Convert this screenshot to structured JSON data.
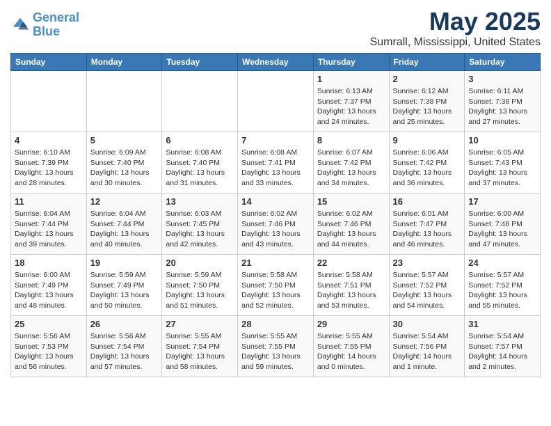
{
  "logo": {
    "text_general": "General",
    "text_blue": "Blue"
  },
  "title": "May 2025",
  "subtitle": "Sumrall, Mississippi, United States",
  "days_of_week": [
    "Sunday",
    "Monday",
    "Tuesday",
    "Wednesday",
    "Thursday",
    "Friday",
    "Saturday"
  ],
  "weeks": [
    [
      {
        "day": "",
        "info": ""
      },
      {
        "day": "",
        "info": ""
      },
      {
        "day": "",
        "info": ""
      },
      {
        "day": "",
        "info": ""
      },
      {
        "day": "1",
        "info": "Sunrise: 6:13 AM\nSunset: 7:37 PM\nDaylight: 13 hours\nand 24 minutes."
      },
      {
        "day": "2",
        "info": "Sunrise: 6:12 AM\nSunset: 7:38 PM\nDaylight: 13 hours\nand 25 minutes."
      },
      {
        "day": "3",
        "info": "Sunrise: 6:11 AM\nSunset: 7:38 PM\nDaylight: 13 hours\nand 27 minutes."
      }
    ],
    [
      {
        "day": "4",
        "info": "Sunrise: 6:10 AM\nSunset: 7:39 PM\nDaylight: 13 hours\nand 28 minutes."
      },
      {
        "day": "5",
        "info": "Sunrise: 6:09 AM\nSunset: 7:40 PM\nDaylight: 13 hours\nand 30 minutes."
      },
      {
        "day": "6",
        "info": "Sunrise: 6:08 AM\nSunset: 7:40 PM\nDaylight: 13 hours\nand 31 minutes."
      },
      {
        "day": "7",
        "info": "Sunrise: 6:08 AM\nSunset: 7:41 PM\nDaylight: 13 hours\nand 33 minutes."
      },
      {
        "day": "8",
        "info": "Sunrise: 6:07 AM\nSunset: 7:42 PM\nDaylight: 13 hours\nand 34 minutes."
      },
      {
        "day": "9",
        "info": "Sunrise: 6:06 AM\nSunset: 7:42 PM\nDaylight: 13 hours\nand 36 minutes."
      },
      {
        "day": "10",
        "info": "Sunrise: 6:05 AM\nSunset: 7:43 PM\nDaylight: 13 hours\nand 37 minutes."
      }
    ],
    [
      {
        "day": "11",
        "info": "Sunrise: 6:04 AM\nSunset: 7:44 PM\nDaylight: 13 hours\nand 39 minutes."
      },
      {
        "day": "12",
        "info": "Sunrise: 6:04 AM\nSunset: 7:44 PM\nDaylight: 13 hours\nand 40 minutes."
      },
      {
        "day": "13",
        "info": "Sunrise: 6:03 AM\nSunset: 7:45 PM\nDaylight: 13 hours\nand 42 minutes."
      },
      {
        "day": "14",
        "info": "Sunrise: 6:02 AM\nSunset: 7:46 PM\nDaylight: 13 hours\nand 43 minutes."
      },
      {
        "day": "15",
        "info": "Sunrise: 6:02 AM\nSunset: 7:46 PM\nDaylight: 13 hours\nand 44 minutes."
      },
      {
        "day": "16",
        "info": "Sunrise: 6:01 AM\nSunset: 7:47 PM\nDaylight: 13 hours\nand 46 minutes."
      },
      {
        "day": "17",
        "info": "Sunrise: 6:00 AM\nSunset: 7:48 PM\nDaylight: 13 hours\nand 47 minutes."
      }
    ],
    [
      {
        "day": "18",
        "info": "Sunrise: 6:00 AM\nSunset: 7:49 PM\nDaylight: 13 hours\nand 48 minutes."
      },
      {
        "day": "19",
        "info": "Sunrise: 5:59 AM\nSunset: 7:49 PM\nDaylight: 13 hours\nand 50 minutes."
      },
      {
        "day": "20",
        "info": "Sunrise: 5:59 AM\nSunset: 7:50 PM\nDaylight: 13 hours\nand 51 minutes."
      },
      {
        "day": "21",
        "info": "Sunrise: 5:58 AM\nSunset: 7:50 PM\nDaylight: 13 hours\nand 52 minutes."
      },
      {
        "day": "22",
        "info": "Sunrise: 5:58 AM\nSunset: 7:51 PM\nDaylight: 13 hours\nand 53 minutes."
      },
      {
        "day": "23",
        "info": "Sunrise: 5:57 AM\nSunset: 7:52 PM\nDaylight: 13 hours\nand 54 minutes."
      },
      {
        "day": "24",
        "info": "Sunrise: 5:57 AM\nSunset: 7:52 PM\nDaylight: 13 hours\nand 55 minutes."
      }
    ],
    [
      {
        "day": "25",
        "info": "Sunrise: 5:56 AM\nSunset: 7:53 PM\nDaylight: 13 hours\nand 56 minutes."
      },
      {
        "day": "26",
        "info": "Sunrise: 5:56 AM\nSunset: 7:54 PM\nDaylight: 13 hours\nand 57 minutes."
      },
      {
        "day": "27",
        "info": "Sunrise: 5:55 AM\nSunset: 7:54 PM\nDaylight: 13 hours\nand 58 minutes."
      },
      {
        "day": "28",
        "info": "Sunrise: 5:55 AM\nSunset: 7:55 PM\nDaylight: 13 hours\nand 59 minutes."
      },
      {
        "day": "29",
        "info": "Sunrise: 5:55 AM\nSunset: 7:55 PM\nDaylight: 14 hours\nand 0 minutes."
      },
      {
        "day": "30",
        "info": "Sunrise: 5:54 AM\nSunset: 7:56 PM\nDaylight: 14 hours\nand 1 minute."
      },
      {
        "day": "31",
        "info": "Sunrise: 5:54 AM\nSunset: 7:57 PM\nDaylight: 14 hours\nand 2 minutes."
      }
    ]
  ]
}
